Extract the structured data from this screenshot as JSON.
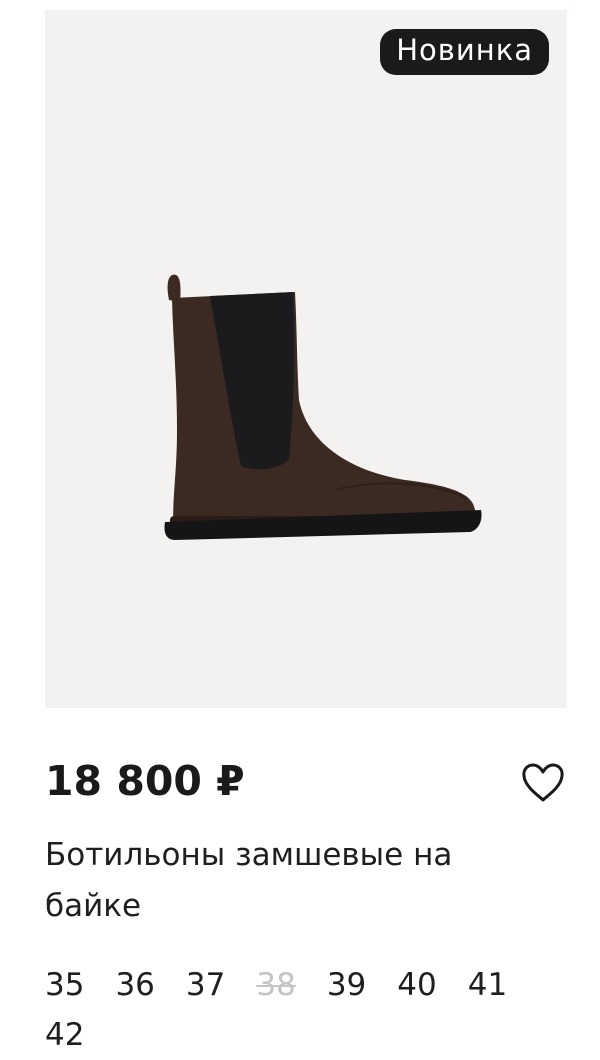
{
  "product": {
    "badge": "Новинка",
    "price": "18 800 ₽",
    "title": "Ботильоны замшевые на байке",
    "image_icon": "boot-image",
    "favorite_icon": "heart-outline-icon",
    "colors": {
      "image_background": "#f3f2f0",
      "boot": "#3b2a22",
      "elastic": "#1b1b1d",
      "sole": "#151515",
      "badge_background": "#1a1a1a",
      "unavailable_size": "#c4c4c4"
    }
  },
  "sizes": [
    {
      "label": "35",
      "available": true
    },
    {
      "label": "36",
      "available": true
    },
    {
      "label": "37",
      "available": true
    },
    {
      "label": "38",
      "available": false
    },
    {
      "label": "39",
      "available": true
    },
    {
      "label": "40",
      "available": true
    },
    {
      "label": "41",
      "available": true
    },
    {
      "label": "42",
      "available": true
    }
  ]
}
